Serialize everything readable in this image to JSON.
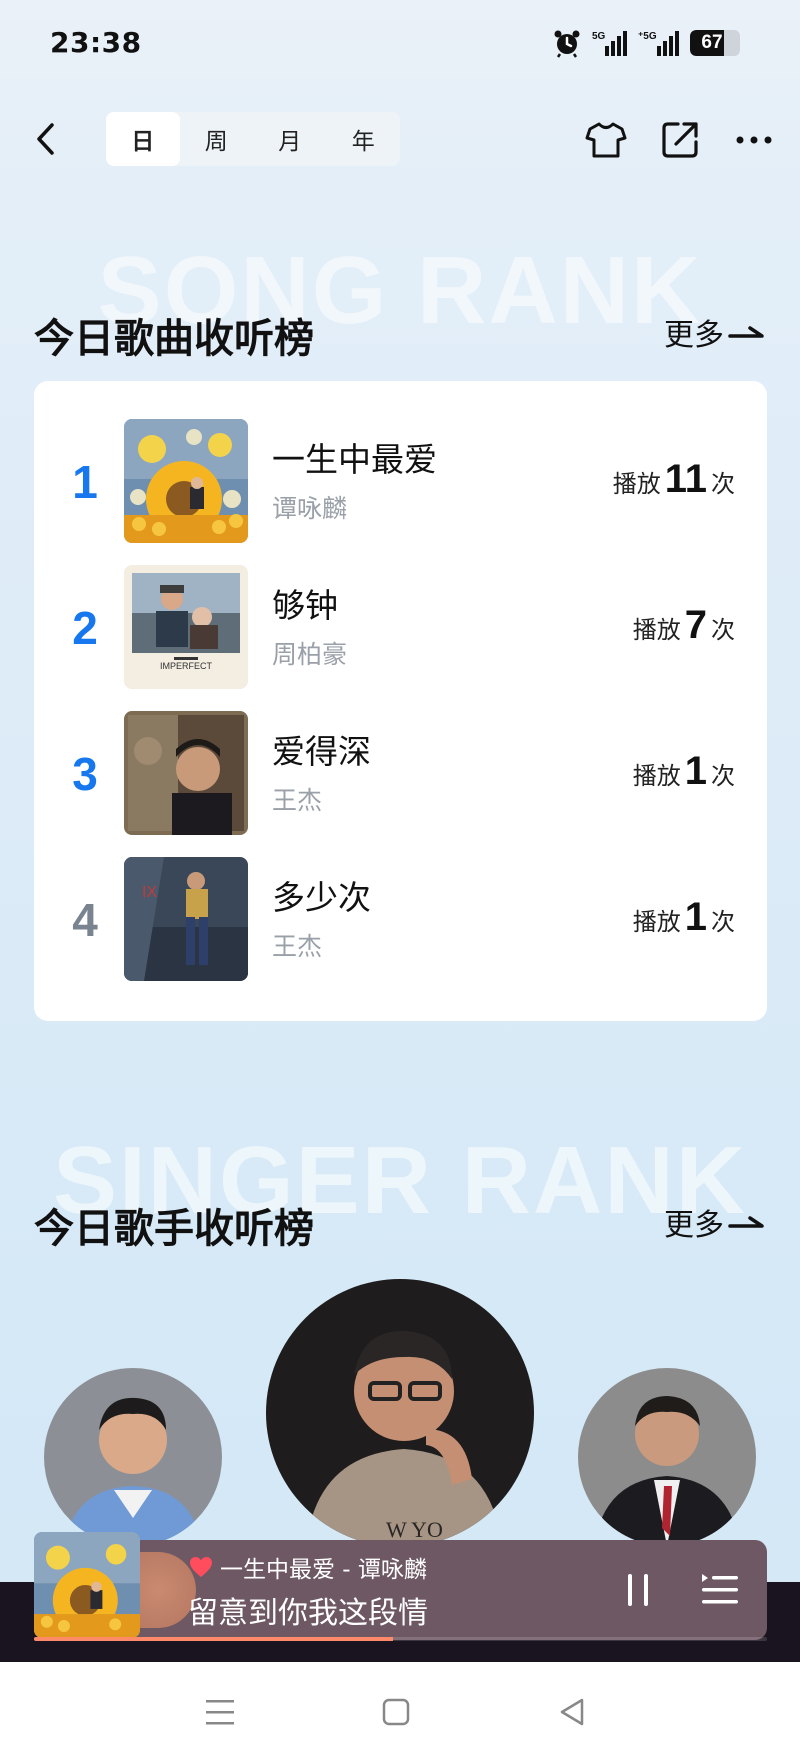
{
  "status_bar": {
    "time": "23:38",
    "battery_level": "67",
    "battery_fraction": 0.67,
    "icons": [
      "alarm-icon",
      "signal-5g-icon",
      "signal-5g-icon",
      "battery-icon"
    ]
  },
  "nav": {
    "back_icon": "chevron-left-icon",
    "tabs": [
      "日",
      "周",
      "月",
      "年"
    ],
    "active_tab": "日",
    "right_icons": [
      "shirt-icon",
      "share-icon",
      "more-icon"
    ]
  },
  "song_rank": {
    "watermark": "SONG RANK",
    "title": "今日歌曲收听榜",
    "more": "更多",
    "play_prefix": "播放",
    "play_suffix": "次",
    "items": [
      {
        "rank": "1",
        "title": "一生中最爱",
        "artist": "谭咏麟",
        "plays": "11"
      },
      {
        "rank": "2",
        "title": "够钟",
        "artist": "周柏豪",
        "plays": "7"
      },
      {
        "rank": "3",
        "title": "爱得深",
        "artist": "王杰",
        "plays": "1"
      },
      {
        "rank": "4",
        "title": "多少次",
        "artist": "王杰",
        "plays": "1"
      }
    ]
  },
  "singer_rank": {
    "watermark": "SINGER RANK",
    "title": "今日歌手收听榜",
    "more": "更多"
  },
  "mini_player": {
    "now_playing": "一生中最爱 - 谭咏麟",
    "lyric": "留意到你我这段情",
    "progress": 0.49,
    "accent": "#ff4d5e"
  },
  "android_nav": {
    "icons": [
      "menu-icon",
      "home-icon",
      "back-icon"
    ]
  }
}
